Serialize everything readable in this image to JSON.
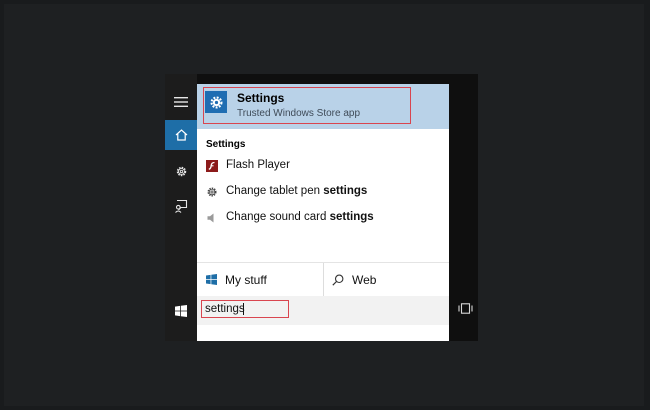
{
  "best_match": {
    "title": "Settings",
    "subtitle": "Trusted Windows Store app",
    "icon": "gear-icon"
  },
  "section_header": "Settings",
  "results": [
    {
      "icon": "flash-icon",
      "label_plain": "Flash Player",
      "label_bold": ""
    },
    {
      "icon": "gear-icon",
      "label_plain": "Change tablet pen ",
      "label_bold": "settings"
    },
    {
      "icon": "speaker-icon",
      "label_plain": "Change sound card ",
      "label_bold": "settings"
    }
  ],
  "scopes": {
    "my_stuff": {
      "label": "My stuff",
      "icon": "windows-logo-icon"
    },
    "web": {
      "label": "Web",
      "icon": "search-icon"
    }
  },
  "search": {
    "value": "settings"
  },
  "rail": {
    "items": [
      "hamburger-menu-icon",
      "home-icon",
      "gear-icon",
      "feedback-icon"
    ],
    "active": "home-icon"
  },
  "colors": {
    "accent": "#1e6ea7",
    "best_match_bg": "#b9d2e8",
    "annotation": "#d9454f"
  }
}
